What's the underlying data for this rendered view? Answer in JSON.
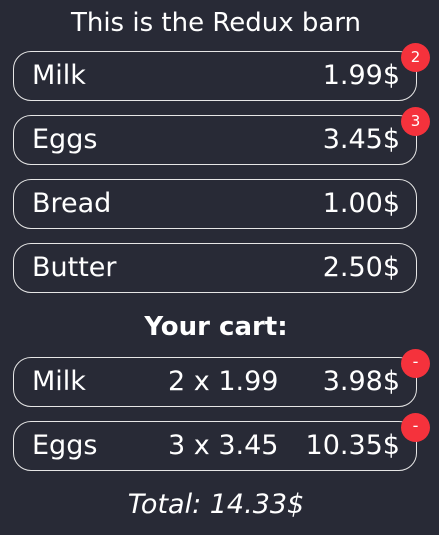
{
  "header": {
    "title": "This is the Redux barn"
  },
  "products": [
    {
      "name": "Milk",
      "price": "1.99$",
      "count": "2"
    },
    {
      "name": "Eggs",
      "price": "3.45$",
      "count": "3"
    },
    {
      "name": "Bread",
      "price": "1.00$"
    },
    {
      "name": "Butter",
      "price": "2.50$"
    }
  ],
  "cart": {
    "heading": "Your cart:",
    "items": [
      {
        "name": "Milk",
        "qty": "2 x 1.99",
        "subtotal": "3.98$",
        "remove_label": "-"
      },
      {
        "name": "Eggs",
        "qty": "3 x 3.45",
        "subtotal": "10.35$",
        "remove_label": "-"
      }
    ],
    "total": "Total: 14.33$"
  },
  "colors": {
    "background": "#282a36",
    "badge": "#f5323c",
    "border": "#e6e6e6",
    "text": "#ffffff"
  }
}
